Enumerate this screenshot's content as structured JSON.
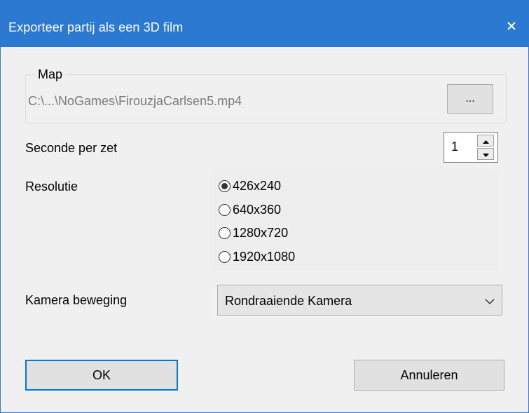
{
  "window": {
    "title": "Exporteer partij als een 3D film"
  },
  "map": {
    "group_label": "Map",
    "path": "C:\\...\\NoGames\\FirouzjaCarlsen5.mp4",
    "browse_label": "..."
  },
  "seconds": {
    "label": "Seconde per zet",
    "value": "1"
  },
  "resolution": {
    "label": "Resolutie",
    "options": [
      {
        "label": "426x240",
        "selected": true
      },
      {
        "label": "640x360",
        "selected": false
      },
      {
        "label": "1280x720",
        "selected": false
      },
      {
        "label": "1920x1080",
        "selected": false
      }
    ]
  },
  "camera": {
    "label": "Kamera beweging",
    "selected": "Rondraaiende Kamera"
  },
  "buttons": {
    "ok": "OK",
    "cancel": "Annuleren"
  },
  "colors": {
    "titlebar": "#2b79d0",
    "dialog_bg": "#f0f0f0",
    "focus_border": "#0078d7"
  }
}
